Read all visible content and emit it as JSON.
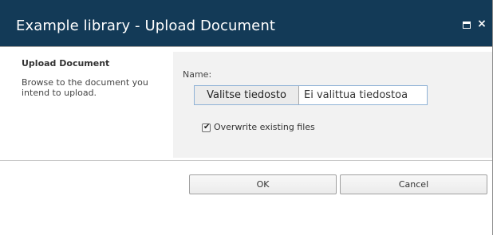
{
  "dialog": {
    "title": "Example library - Upload Document",
    "window_controls": {
      "maximize_icon": "maximize-icon",
      "close_icon": "close-icon",
      "close_glyph": "×"
    }
  },
  "left_panel": {
    "title": "Upload Document",
    "description": "Browse to the document you intend to upload."
  },
  "form": {
    "name_label": "Name:",
    "file_button_label": "Valitse tiedosto",
    "file_status": "Ei valittua tiedostoa",
    "overwrite_label": "Overwrite existing files",
    "overwrite_checked": true
  },
  "buttons": {
    "ok": "OK",
    "cancel": "Cancel"
  },
  "colors": {
    "titlebar": "#133a57",
    "form_background": "#f2f2f2"
  }
}
